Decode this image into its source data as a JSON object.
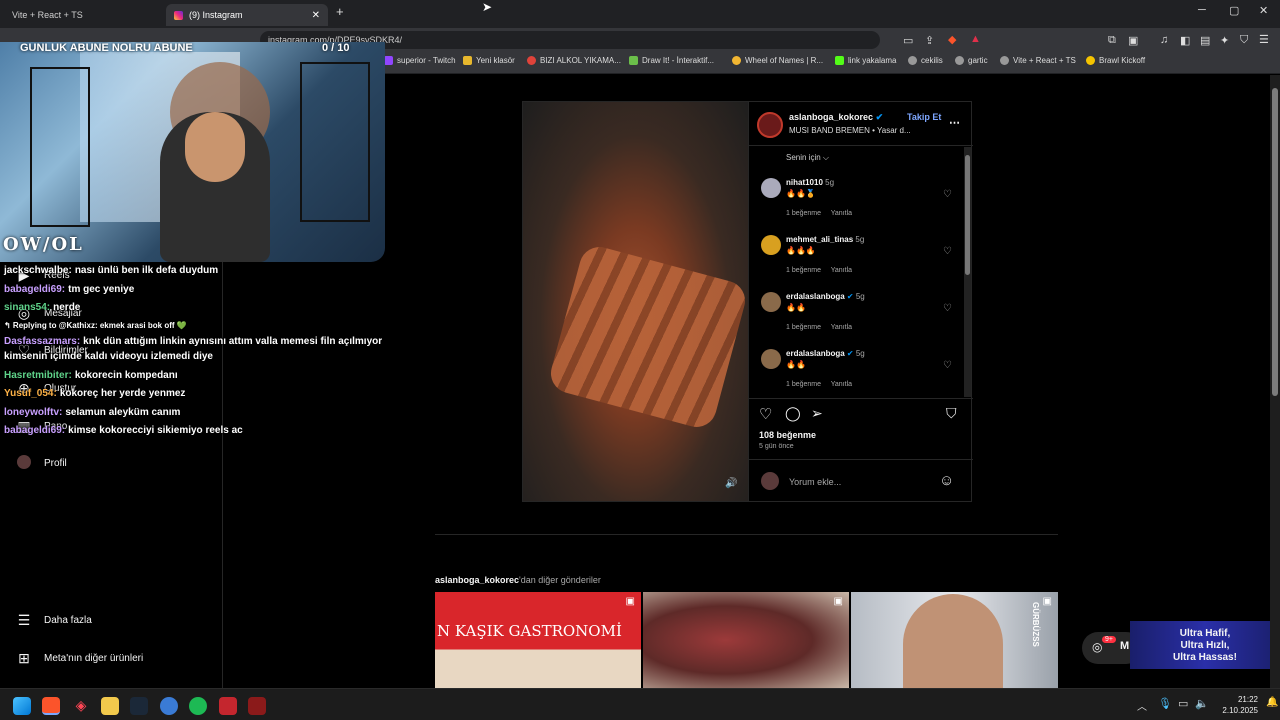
{
  "tabs": [
    {
      "label": "Vite + React + TS"
    },
    {
      "label": "(9) Instagram"
    }
  ],
  "overlay_title": "GUNLUK ABUNE NOLRU ABUNE",
  "overlay_counter": "0  / 10",
  "address": {
    "url": "instagram.com/p/DPE9svSDKR4/"
  },
  "bookmarks": [
    "superior - Twitch",
    "Yeni klasör",
    "BIZI ALKOL YIKAMA...",
    "Draw It! - İnteraktif...",
    "Wheel of Names | R...",
    "link yakalama",
    "cekilis",
    "gartic",
    "Vite + React + TS",
    "Brawl Kickoff"
  ],
  "webcam_logo": "OW/OL",
  "sidebar": {
    "items": [
      {
        "label": "Reels",
        "icon": "reels-icon",
        "glyph": "▶"
      },
      {
        "label": "Mesajlar",
        "icon": "messages-icon",
        "glyph": "◎"
      },
      {
        "label": "Bildirimler",
        "icon": "notifications-icon",
        "glyph": "♡"
      },
      {
        "label": "Oluştur",
        "icon": "create-icon",
        "glyph": "⊕"
      },
      {
        "label": "Pano",
        "icon": "dashboard-icon",
        "glyph": "▥"
      },
      {
        "label": "Profil",
        "icon": "profile-avatar",
        "glyph": ""
      }
    ],
    "more": "Daha fazla",
    "meta": "Meta'nın diğer ürünleri"
  },
  "chat": [
    {
      "user": "jackschwalbe:",
      "msg": "nası ünlü ben ilk defa duydum",
      "color": "#ffffff"
    },
    {
      "user": "babageldi69:",
      "msg": "tm gec yeniye",
      "color": "#c9a0ff"
    },
    {
      "user": "sinans54:",
      "msg": "nerde",
      "color": "#5fd38a"
    },
    {
      "reply": "↰ Replying to @Kathixz: ekmek arasi bok off 💚"
    },
    {
      "user": "Dasfassazmars:",
      "msg": "knk dün attığım linkin aynısını attım valla memesi filn açılmıyor kimsenin içimde kaldı videoyu izlemedi diye",
      "color": "#c9a0ff"
    },
    {
      "user": "Hasretmibiter:",
      "msg": "kokorecin kompedanı",
      "color": "#5fd38a"
    },
    {
      "user": "Yusuf_054:",
      "msg": "kokoreç her yerde yenmez",
      "color": "#ffb347"
    },
    {
      "user": "loneywolftv:",
      "msg": "selamun aleyküm canım",
      "color": "#c9a0ff"
    },
    {
      "user": "babageldi69:",
      "msg": "kimse kokorecciyi sikiemiyo reels ac",
      "color": "#c9a0ff"
    }
  ],
  "post": {
    "username": "aslanboga_kokorec",
    "follow": "Takip Et",
    "audio": "MUSI BAND BREMEN • Yasar d...",
    "sort": "Senin için ⌵",
    "comments": [
      {
        "user": "nihat1010",
        "time": "5g",
        "text": "🔥🔥🏅",
        "likes": "1 beğenme",
        "reply": "Yanıtla"
      },
      {
        "user": "mehmet_ali_tinas",
        "time": "5g",
        "text": "🔥🔥🔥",
        "likes": "1 beğenme",
        "reply": "Yanıtla"
      },
      {
        "user": "erdalaslanboga",
        "time": "5g",
        "text": "🔥🔥",
        "likes": "1 beğenme",
        "reply": "Yanıtla"
      },
      {
        "user": "erdalaslanboga",
        "time": "5g",
        "text": "🔥🔥",
        "likes": "1 beğenme",
        "reply": "Yanıtla"
      }
    ],
    "likes": "108 beğenme",
    "ago": "5 gün önce",
    "comment_placeholder": "Yorum ekle..."
  },
  "more_posts": {
    "user": "aslanboga_kokorec",
    "suffix": "'dan diğer gönderiler",
    "thumb1_text": "N KAŞIK GASTRONOMİ",
    "thumb3_text": "GÜRBÜZSS"
  },
  "ad": {
    "line1": "Ultra Hafif,",
    "line2": "Ultra Hızlı,",
    "line3": "Ultra Hassas!",
    "badge": "9+",
    "m": "M"
  },
  "clock": {
    "time": "21:22",
    "date": "2.10.2025"
  }
}
